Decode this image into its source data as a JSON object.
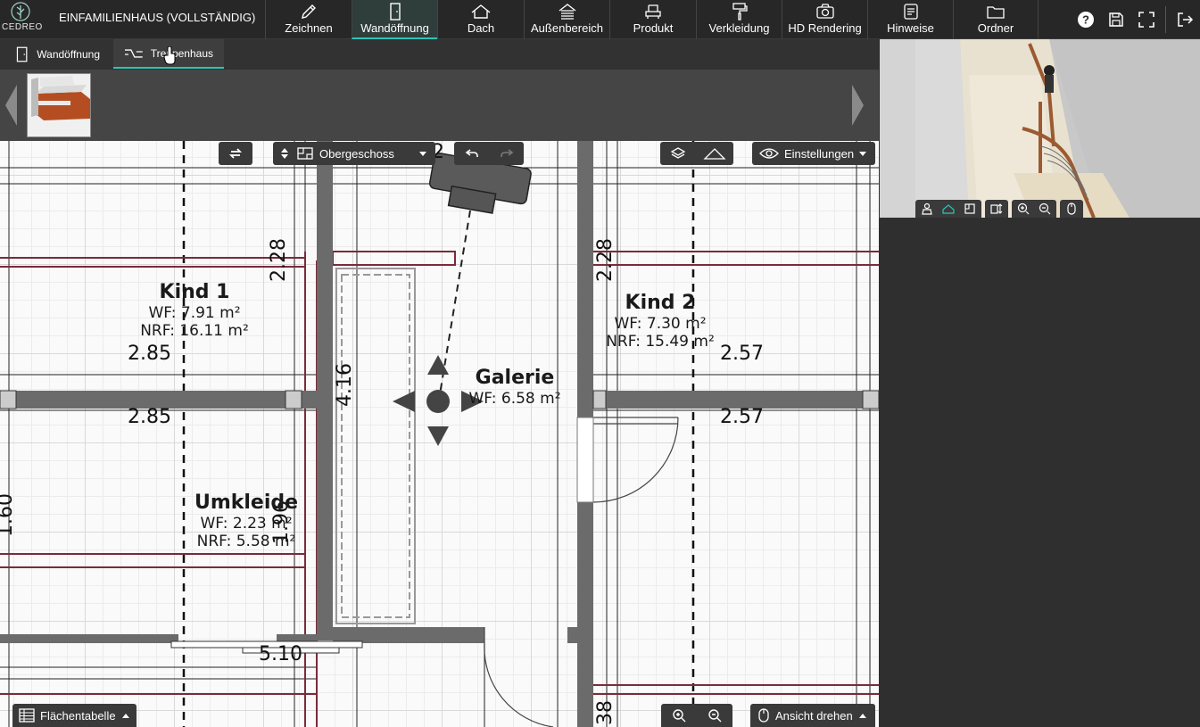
{
  "app": {
    "logo_text": "CEDREO",
    "project_title": "EINFAMILIENHAUS (VOLLSTÄNDIG)"
  },
  "nav": [
    {
      "label": "Zeichnen",
      "icon": "pencil-icon"
    },
    {
      "label": "Wandöffnung",
      "icon": "door-icon",
      "active": true
    },
    {
      "label": "Dach",
      "icon": "roof-icon"
    },
    {
      "label": "Außenbereich",
      "icon": "exterior-icon"
    },
    {
      "label": "Produkt",
      "icon": "armchair-icon"
    },
    {
      "label": "Verkleidung",
      "icon": "paint-roller-icon"
    },
    {
      "label": "HD Rendering",
      "icon": "camera-icon"
    },
    {
      "label": "Hinweise",
      "icon": "notes-icon"
    },
    {
      "label": "Ordner",
      "icon": "folder-icon"
    }
  ],
  "top_actions": [
    "help-icon",
    "save-icon",
    "fullscreen-icon",
    "logout-icon"
  ],
  "subtabs": [
    {
      "label": "Wandöffnung",
      "icon": "door-icon"
    },
    {
      "label": "Treppenhaus",
      "icon": "stairs-icon",
      "active": true
    }
  ],
  "plan_toolbar": {
    "floor": "Obergeschoss",
    "settings": "Einstellungen"
  },
  "rooms": {
    "kind1": {
      "name": "Kind 1",
      "wf": "WF: 7.91 m²",
      "nrf": "NRF: 16.11 m²"
    },
    "kind2": {
      "name": "Kind 2",
      "wf": "WF: 7.30 m²",
      "nrf": "NRF: 15.49 m²"
    },
    "galerie": {
      "name": "Galerie",
      "wf": "WF: 6.58 m²"
    },
    "umkleide": {
      "name": "Umkleide",
      "wf": "WF: 2.23 m²",
      "nrf": "NRF: 5.58 m²"
    }
  },
  "dimensions": {
    "d1": "2.28",
    "d2": "2.28",
    "d3": "2.85",
    "d4": "2.85",
    "d5": "2.57",
    "d6": "2.57",
    "d7": "4.16",
    "d8": "5.10",
    "d9": "1.96",
    "d10": "2",
    "d11": "38",
    "d12": "1.60"
  },
  "bottom": {
    "area_table": "Flächentabelle",
    "rotate_view": "Ansicht drehen"
  },
  "colors": {
    "accent": "#2ec4b6",
    "wall": "#6b6b6b",
    "room_outline": "#7a2b3a"
  }
}
